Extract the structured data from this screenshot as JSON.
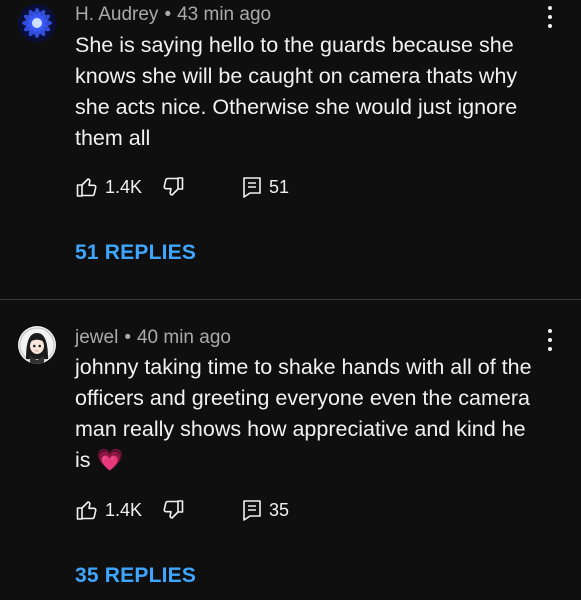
{
  "comments": [
    {
      "author": "H. Audrey",
      "separator": "•",
      "time": "43 min ago",
      "text": "She is saying hello to the guards because she knows she will be caught on camera thats why she acts nice. Otherwise she would just ignore them all",
      "emoji": "",
      "likes": "1.4K",
      "reply_count": "51",
      "view_replies_label": "51 REPLIES",
      "avatar_icon": "blue-flower-avatar"
    },
    {
      "author": "jewel",
      "separator": "•",
      "time": "40 min ago",
      "text": "johnny taking time to shake hands with all of the officers and greeting everyone even the camera man really shows how appreciative and kind he is ",
      "emoji": "💗",
      "likes": "1.4K",
      "reply_count": "35",
      "view_replies_label": "35 REPLIES",
      "avatar_icon": "anime-girl-avatar"
    }
  ],
  "colors": {
    "background": "#0f0f0f",
    "text": "#f1f1f1",
    "meta": "#aaaaaa",
    "link": "#3ea6ff",
    "divider": "#3a3a3a"
  }
}
